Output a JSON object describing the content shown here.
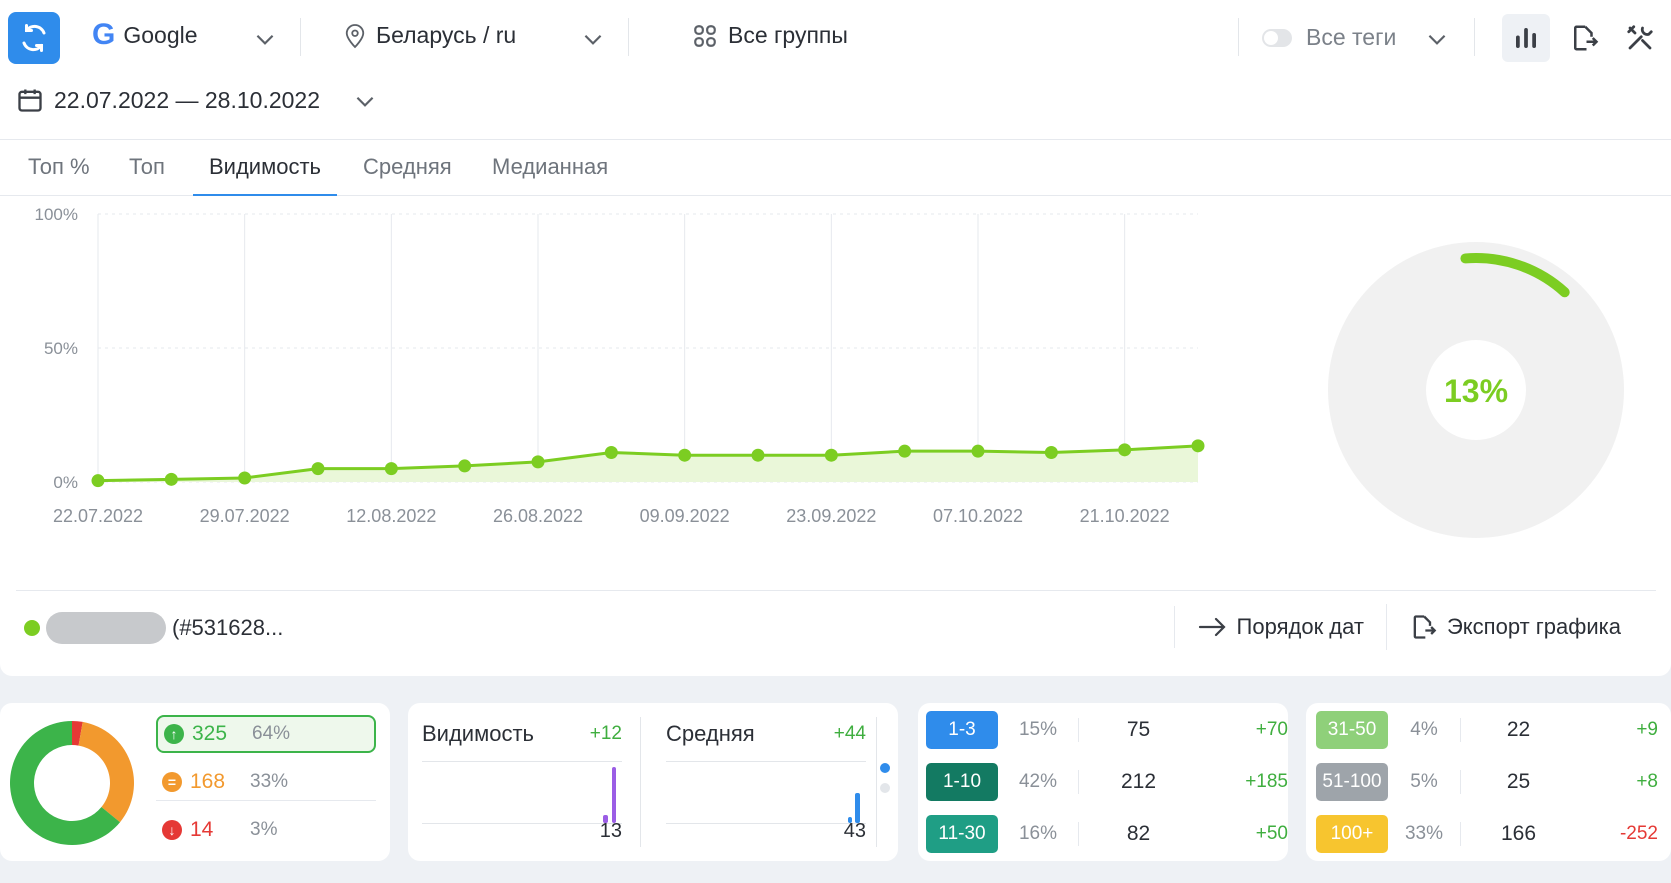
{
  "header": {
    "engine": "Google",
    "region": "Беларусь / ru",
    "groups": "Все группы",
    "tags": "Все теги",
    "date_range": "22.07.2022 — 28.10.2022"
  },
  "tabs": [
    {
      "label": "Топ %"
    },
    {
      "label": "Топ"
    },
    {
      "label": "Видимость",
      "active": true
    },
    {
      "label": "Средняя"
    },
    {
      "label": "Медианная"
    }
  ],
  "chart_data": {
    "type": "area",
    "x": [
      "22.07.2022",
      "25.07.2022",
      "29.07.2022",
      "05.08.2022",
      "12.08.2022",
      "19.08.2022",
      "26.08.2022",
      "02.09.2022",
      "09.09.2022",
      "16.09.2022",
      "23.09.2022",
      "30.09.2022",
      "07.10.2022",
      "14.10.2022",
      "21.10.2022",
      "28.10.2022"
    ],
    "x_ticks": [
      "22.07.2022",
      "29.07.2022",
      "12.08.2022",
      "26.08.2022",
      "09.09.2022",
      "23.09.2022",
      "07.10.2022",
      "21.10.2022"
    ],
    "series": [
      {
        "values": [
          0.5,
          1,
          1.5,
          5,
          5,
          6,
          7.5,
          11,
          10,
          10,
          10,
          11.5,
          11.5,
          11,
          12,
          13.5
        ],
        "color": "#7ccd22"
      }
    ],
    "y_ticks": [
      "100%",
      "50%",
      "0%"
    ],
    "ylim": [
      0,
      100
    ],
    "grid": true
  },
  "gauge": {
    "value": 13,
    "label": "13%",
    "color": "#7ccd22"
  },
  "legend": {
    "id": "(#531628..."
  },
  "actions": {
    "date_order": "Порядок дат",
    "export": "Экспорт графика"
  },
  "summary": {
    "rows": [
      {
        "value": "325",
        "pct": "64%",
        "color": "#3cb44a",
        "icon": "arrow-up-icon"
      },
      {
        "value": "168",
        "pct": "33%",
        "color": "#f2992e",
        "icon": "equal-icon"
      },
      {
        "value": "14",
        "pct": "3%",
        "color": "#e53935",
        "icon": "arrow-down-icon"
      }
    ]
  },
  "metrics": [
    {
      "label": "Видимость",
      "delta": "+12",
      "value": "13",
      "color": "#9b5de5"
    },
    {
      "label": "Средняя",
      "delta": "+44",
      "value": "43",
      "color": "#2f8ceb"
    }
  ],
  "ranks": [
    {
      "range": "1-3",
      "pct": "15%",
      "count": "75",
      "delta": "+70",
      "color": "#2f8ceb",
      "delta_color": "#3fae3f"
    },
    {
      "range": "1-10",
      "pct": "42%",
      "count": "212",
      "delta": "+185",
      "color": "#137a62",
      "delta_color": "#3fae3f"
    },
    {
      "range": "11-30",
      "pct": "16%",
      "count": "82",
      "delta": "+50",
      "color": "#1f9e85",
      "delta_color": "#3fae3f"
    },
    {
      "range": "31-50",
      "pct": "4%",
      "count": "22",
      "delta": "+9",
      "color": "#8fd07a",
      "delta_color": "#3fae3f"
    },
    {
      "range": "51-100",
      "pct": "5%",
      "count": "25",
      "delta": "+8",
      "color": "#9ea4aa",
      "delta_color": "#3fae3f"
    },
    {
      "range": "100+",
      "pct": "33%",
      "count": "166",
      "delta": "-252",
      "color": "#f7c52f",
      "delta_color": "#e53935"
    }
  ]
}
